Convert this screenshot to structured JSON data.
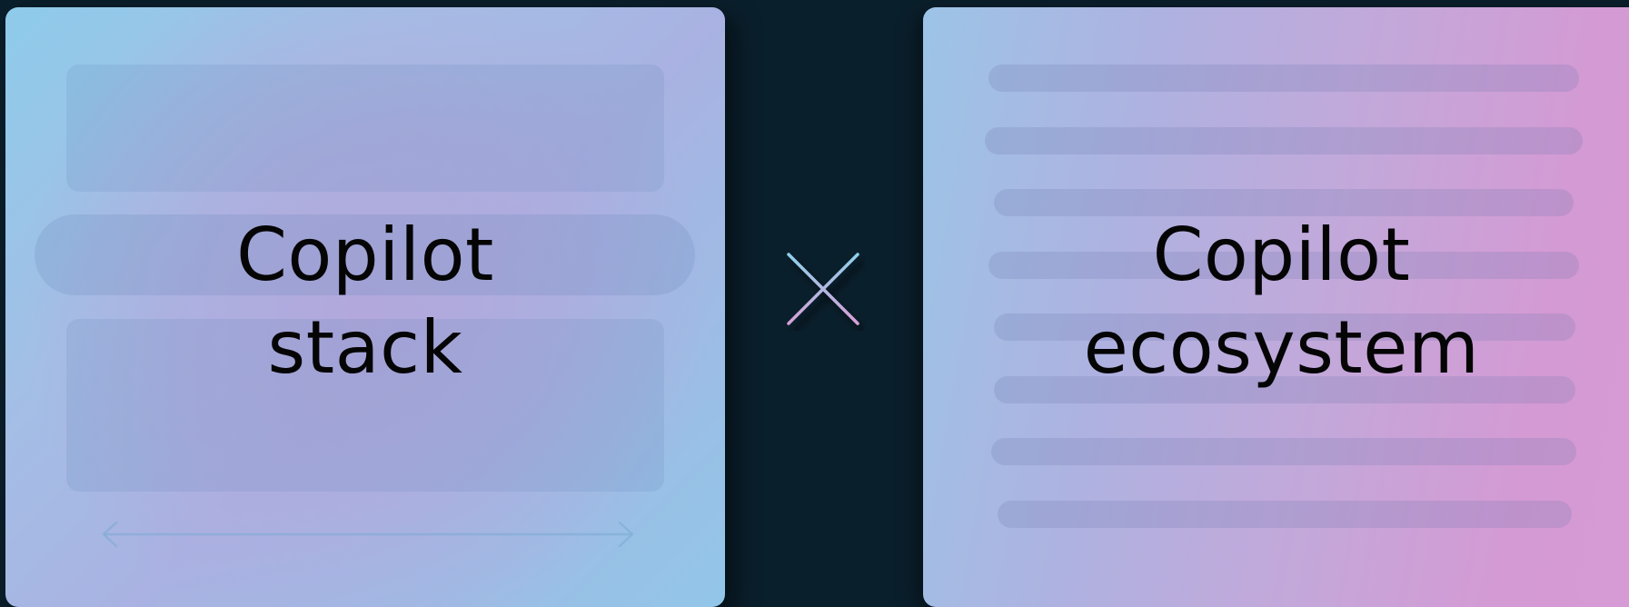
{
  "left_card": {
    "title_line1": "Copilot",
    "title_line2": "stack",
    "decor_icon": "double-arrow-icon"
  },
  "center": {
    "icon": "cross-icon"
  },
  "right_card": {
    "title_line1": "Copilot",
    "title_line2": "ecosystem"
  },
  "colors": {
    "background": "#0a1f2c",
    "left_card_blue": "#8ecbea",
    "left_card_lavender": "#b2a8dc",
    "right_card_pink": "#d79ad4",
    "cross_blue": "#8ed0ea",
    "cross_pink": "#d6a0d8"
  }
}
